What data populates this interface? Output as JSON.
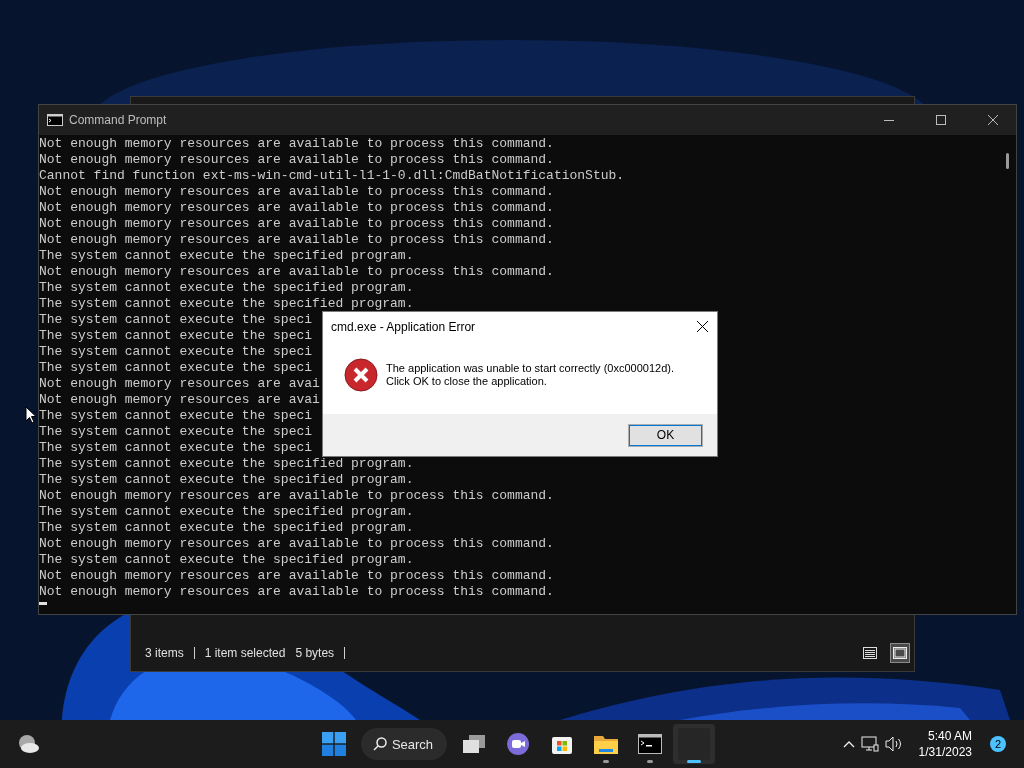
{
  "explorer_window": {
    "status_bar": {
      "item_count": "3 items",
      "selection": "1 item selected",
      "size": "5 bytes"
    },
    "view_buttons": [
      {
        "kind": "details",
        "selected": false
      },
      {
        "kind": "preview",
        "selected": true
      }
    ]
  },
  "console_window": {
    "title": "Command Prompt",
    "lines": [
      "Not enough memory resources are available to process this command.",
      "Not enough memory resources are available to process this command.",
      "Cannot find function ext-ms-win-cmd-util-l1-1-0.dll:CmdBatNotificationStub.",
      "Not enough memory resources are available to process this command.",
      "Not enough memory resources are available to process this command.",
      "Not enough memory resources are available to process this command.",
      "Not enough memory resources are available to process this command.",
      "The system cannot execute the specified program.",
      "Not enough memory resources are available to process this command.",
      "The system cannot execute the specified program.",
      "The system cannot execute the specified program.",
      "The system cannot execute the speci",
      "The system cannot execute the speci",
      "The system cannot execute the speci",
      "The system cannot execute the speci",
      "Not enough memory resources are avai",
      "Not enough memory resources are avai",
      "The system cannot execute the speci",
      "The system cannot execute the speci",
      "The system cannot execute the speci",
      "The system cannot execute the specified program.",
      "The system cannot execute the specified program.",
      "Not enough memory resources are available to process this command.",
      "The system cannot execute the specified program.",
      "The system cannot execute the specified program.",
      "Not enough memory resources are available to process this command.",
      "The system cannot execute the specified program.",
      "Not enough memory resources are available to process this command.",
      "Not enough memory resources are available to process this command."
    ]
  },
  "error_dialog": {
    "title": "cmd.exe - Application Error",
    "message": [
      "The application was unable to start correctly (0xc000012d).",
      "Click OK to close the application."
    ],
    "button": "OK"
  },
  "taskbar": {
    "search": "Search",
    "apps": [
      {
        "kind": "taskview",
        "running": false,
        "active": false
      },
      {
        "kind": "chat",
        "running": false,
        "active": false
      },
      {
        "kind": "store",
        "running": false,
        "active": false
      },
      {
        "kind": "folder",
        "running": true,
        "active": false
      },
      {
        "kind": "terminal",
        "running": true,
        "active": false
      },
      {
        "kind": "blank",
        "running": true,
        "active": true
      }
    ],
    "time": "5:40 AM",
    "date": "1/31/2023",
    "notification_count": "2"
  }
}
